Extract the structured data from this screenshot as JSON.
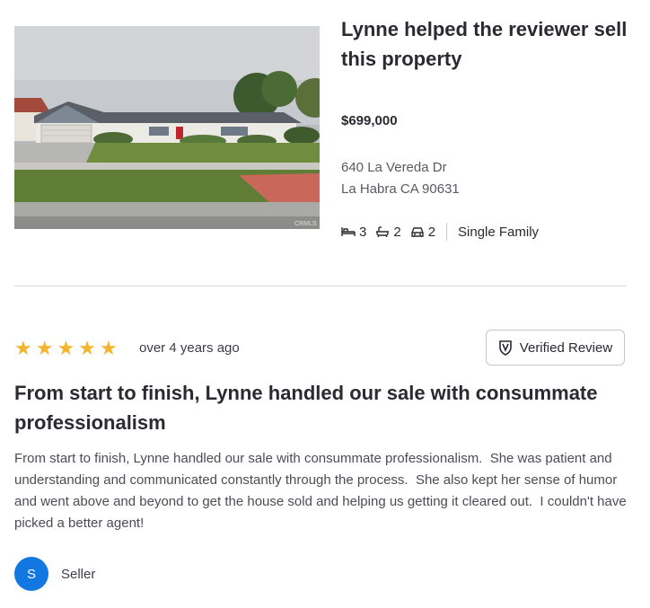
{
  "property": {
    "heading": "Lynne helped the reviewer sell this property",
    "price": "$699,000",
    "address_line1": "640 La Vereda Dr",
    "address_line2": "La Habra CA 90631",
    "beds": "3",
    "baths": "2",
    "parking": "2",
    "type": "Single Family",
    "photo_watermark": "CRMLS"
  },
  "review": {
    "rating": 5,
    "stars": [
      "★",
      "★",
      "★",
      "★",
      "★"
    ],
    "time_ago": "over 4 years ago",
    "verified_label": "Verified Review",
    "title": "From start to finish, Lynne handled our sale with consummate professionalism",
    "body": "From start to finish, Lynne handled our sale with consummate professionalism.  She was patient and understanding and communicated constantly through the process.  She also kept her sense of humor and went above and beyond to get the house sold and helping us getting it cleared out.  I couldn't have picked a better agent!",
    "reviewer_initial": "S",
    "reviewer_role": "Seller"
  },
  "colors": {
    "star": "#f3b530",
    "avatar": "#1277e1",
    "text": "#2a2a33"
  },
  "icons": {
    "beds": "bed-icon",
    "baths": "bath-icon",
    "parking": "car-icon",
    "verified": "shield-check-icon"
  }
}
